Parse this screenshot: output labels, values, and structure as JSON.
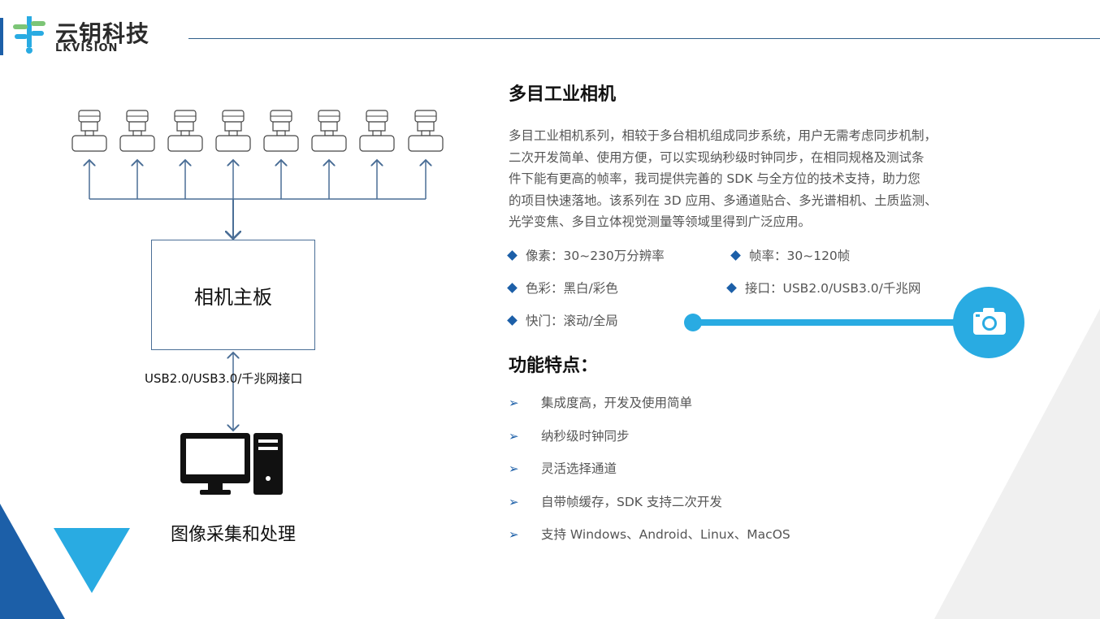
{
  "brand": {
    "name_cn": "云钥科技",
    "name_en": "LKVISION"
  },
  "product": {
    "title": "多目工业相机",
    "description": [
      "多目工业相机系列，相较于多台相机组成同步系统，用户无需考虑同步机制，",
      "二次开发简单、使用方便，可以实现纳秒级时钟同步，在相同规格及测试条",
      "件下能有更高的帧率，我司提供完善的 SDK 与全方位的技术支持，助力您",
      "的项目快速落地。该系列在 3D 应用、多通道贴合、多光谱相机、土质监测、",
      "光学变焦、多目立体视觉测量等领域里得到广泛应用。"
    ]
  },
  "specs": [
    "像素：30~230万分辨率",
    "帧率：30~120帧",
    "色彩：黑白/彩色",
    "接口：USB2.0/USB3.0/千兆网",
    "快门：滚动/全局"
  ],
  "features": {
    "title": "功能特点：",
    "items": [
      "集成度高，开发及使用简单",
      "纳秒级时钟同步",
      "灵活选择通道",
      "自带帧缓存，SDK 支持二次开发",
      "支持 Windows、Android、Linux、MacOS"
    ]
  },
  "diagram": {
    "board_label": "相机主板",
    "interface_label": "USB2.0/USB3.0/千兆网接口",
    "pc_label": "图像采集和处理",
    "camera_count": 8
  },
  "colors": {
    "primary_blue": "#1c5fa8",
    "light_blue": "#29abe2",
    "line_blue": "#4a6e96"
  },
  "icons": {
    "camera": "camera-icon",
    "computer": "computer-icon",
    "brand": "brand-logo-icon"
  }
}
